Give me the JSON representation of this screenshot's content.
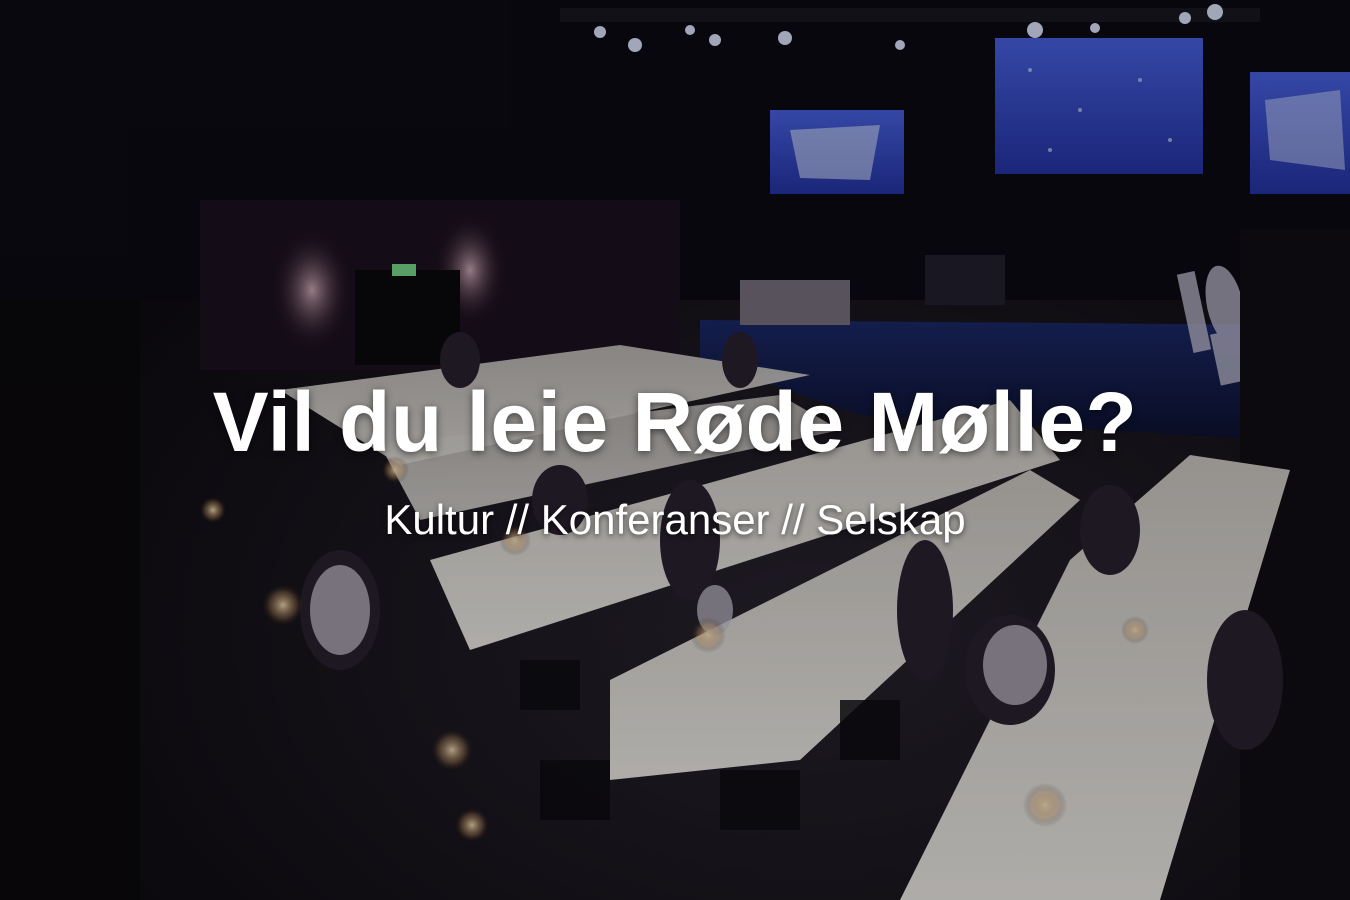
{
  "hero": {
    "title": "Vil du leie Røde Mølle?",
    "subtitle": "Kultur // Konferanser // Selskap",
    "background_image": "banquet-hall-photo",
    "colors": {
      "text": "#ffffff",
      "overlay": "#000000",
      "screen_glow": "#3a55d8",
      "tablecloth": "#e8e6e2"
    }
  }
}
